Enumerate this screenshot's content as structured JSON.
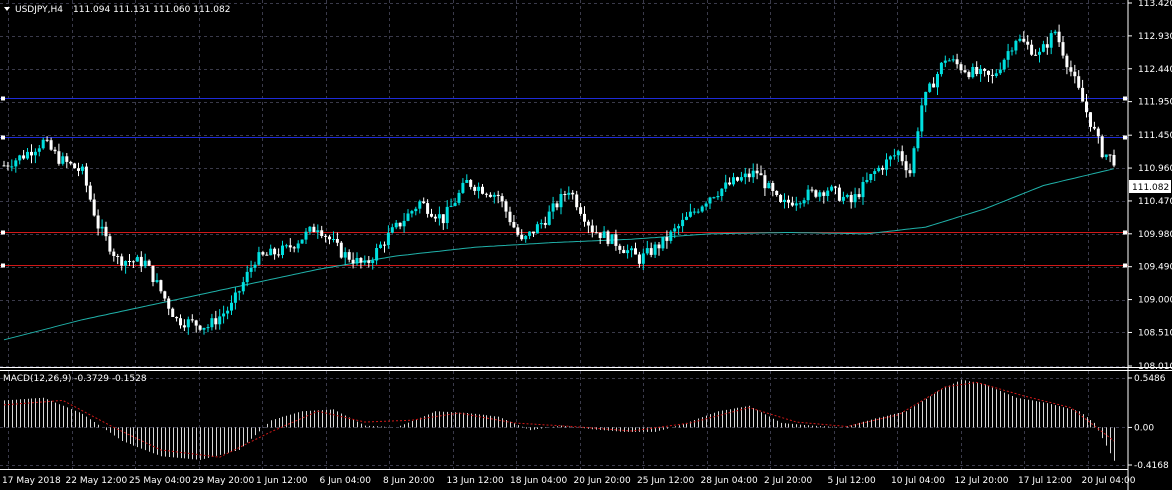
{
  "header": {
    "symbol": "USDJPY,H4",
    "ohlc": "111.094 111.131 111.060 111.082"
  },
  "macd_header": {
    "label": "MACD(12,26,9) -0.3729 -0.1528"
  },
  "price_axis": {
    "ticks": [
      "113.420",
      "112.930",
      "112.440",
      "111.950",
      "111.450",
      "110.960",
      "110.470",
      "109.980",
      "109.490",
      "109.000",
      "108.510",
      "108.010"
    ],
    "current_price": "111.082"
  },
  "macd_axis": {
    "ticks": [
      "0.5486",
      "0.00",
      "-0.4168"
    ]
  },
  "time_axis": {
    "labels": [
      "17 May 2018",
      "22 May 12:00",
      "25 May 04:00",
      "29 May 20:00",
      "1 Jun 12:00",
      "6 Jun 04:00",
      "8 Jun 20:00",
      "13 Jun 12:00",
      "18 Jun 04:00",
      "20 Jun 20:00",
      "25 Jun 12:00",
      "28 Jun 04:00",
      "2 Jul 20:00",
      "5 Jul 12:00",
      "10 Jul 04:00",
      "12 Jul 20:00",
      "17 Jul 12:00",
      "20 Jul 04:00"
    ]
  },
  "horizontal_levels": {
    "blue": [
      112.0,
      111.42
    ],
    "red": [
      110.0,
      109.52
    ]
  },
  "colors": {
    "background": "#000000",
    "grid": "#3a3a4a",
    "axis": "#ffffff",
    "bull_candle": "#00e0e0",
    "bear_candle": "#ffffff",
    "moving_average": "#20b2aa",
    "blue_level": "#1e2bd8",
    "red_level": "#d01818",
    "macd_hist": "#d8d8d8",
    "macd_signal": "#d01818"
  },
  "chart_data": {
    "type": "candlestick",
    "title": "USDJPY,H4",
    "y_range": [
      108.01,
      113.42
    ],
    "key_points": [
      {
        "i": 0,
        "p": 111.0
      },
      {
        "i": 5,
        "p": 111.15
      },
      {
        "i": 10,
        "p": 111.35
      },
      {
        "i": 14,
        "p": 111.1
      },
      {
        "i": 20,
        "p": 110.9
      },
      {
        "i": 24,
        "p": 110.1
      },
      {
        "i": 29,
        "p": 109.6
      },
      {
        "i": 36,
        "p": 109.55
      },
      {
        "i": 44,
        "p": 108.7
      },
      {
        "i": 52,
        "p": 108.6
      },
      {
        "i": 58,
        "p": 108.9
      },
      {
        "i": 64,
        "p": 109.6
      },
      {
        "i": 72,
        "p": 109.75
      },
      {
        "i": 80,
        "p": 110.1
      },
      {
        "i": 86,
        "p": 109.7
      },
      {
        "i": 92,
        "p": 109.5
      },
      {
        "i": 98,
        "p": 109.95
      },
      {
        "i": 106,
        "p": 110.45
      },
      {
        "i": 112,
        "p": 110.2
      },
      {
        "i": 118,
        "p": 110.75
      },
      {
        "i": 126,
        "p": 110.55
      },
      {
        "i": 132,
        "p": 109.85
      },
      {
        "i": 138,
        "p": 110.2
      },
      {
        "i": 144,
        "p": 110.65
      },
      {
        "i": 150,
        "p": 110.05
      },
      {
        "i": 156,
        "p": 109.85
      },
      {
        "i": 162,
        "p": 109.6
      },
      {
        "i": 168,
        "p": 109.85
      },
      {
        "i": 174,
        "p": 110.2
      },
      {
        "i": 180,
        "p": 110.55
      },
      {
        "i": 186,
        "p": 110.75
      },
      {
        "i": 192,
        "p": 110.9
      },
      {
        "i": 198,
        "p": 110.4
      },
      {
        "i": 204,
        "p": 110.55
      },
      {
        "i": 210,
        "p": 110.65
      },
      {
        "i": 216,
        "p": 110.45
      },
      {
        "i": 222,
        "p": 110.9
      },
      {
        "i": 228,
        "p": 111.2
      },
      {
        "i": 231,
        "p": 110.9
      },
      {
        "i": 234,
        "p": 111.9
      },
      {
        "i": 240,
        "p": 112.6
      },
      {
        "i": 246,
        "p": 112.4
      },
      {
        "i": 252,
        "p": 112.3
      },
      {
        "i": 258,
        "p": 112.9
      },
      {
        "i": 264,
        "p": 112.65
      },
      {
        "i": 268,
        "p": 113.0
      },
      {
        "i": 272,
        "p": 112.4
      },
      {
        "i": 276,
        "p": 111.8
      },
      {
        "i": 280,
        "p": 111.2
      },
      {
        "i": 283,
        "p": 111.08
      }
    ],
    "moving_average": [
      {
        "i": 0,
        "p": 108.4
      },
      {
        "i": 20,
        "p": 108.7
      },
      {
        "i": 40,
        "p": 108.95
      },
      {
        "i": 60,
        "p": 109.2
      },
      {
        "i": 80,
        "p": 109.45
      },
      {
        "i": 100,
        "p": 109.65
      },
      {
        "i": 120,
        "p": 109.78
      },
      {
        "i": 140,
        "p": 109.85
      },
      {
        "i": 160,
        "p": 109.9
      },
      {
        "i": 180,
        "p": 109.98
      },
      {
        "i": 200,
        "p": 110.0
      },
      {
        "i": 220,
        "p": 109.98
      },
      {
        "i": 235,
        "p": 110.08
      },
      {
        "i": 250,
        "p": 110.35
      },
      {
        "i": 265,
        "p": 110.7
      },
      {
        "i": 283,
        "p": 110.95
      }
    ],
    "macd_hist": [
      {
        "i": 0,
        "v": 0.3
      },
      {
        "i": 10,
        "v": 0.33
      },
      {
        "i": 20,
        "v": 0.15
      },
      {
        "i": 30,
        "v": -0.15
      },
      {
        "i": 40,
        "v": -0.32
      },
      {
        "i": 50,
        "v": -0.36
      },
      {
        "i": 60,
        "v": -0.25
      },
      {
        "i": 68,
        "v": 0.08
      },
      {
        "i": 76,
        "v": 0.18
      },
      {
        "i": 84,
        "v": 0.2
      },
      {
        "i": 92,
        "v": 0.02
      },
      {
        "i": 100,
        "v": 0.0
      },
      {
        "i": 110,
        "v": 0.18
      },
      {
        "i": 118,
        "v": 0.16
      },
      {
        "i": 126,
        "v": 0.12
      },
      {
        "i": 134,
        "v": -0.03
      },
      {
        "i": 142,
        "v": 0.02
      },
      {
        "i": 150,
        "v": -0.02
      },
      {
        "i": 158,
        "v": -0.05
      },
      {
        "i": 166,
        "v": -0.05
      },
      {
        "i": 174,
        "v": 0.05
      },
      {
        "i": 182,
        "v": 0.18
      },
      {
        "i": 190,
        "v": 0.24
      },
      {
        "i": 198,
        "v": 0.05
      },
      {
        "i": 206,
        "v": 0.02
      },
      {
        "i": 214,
        "v": 0.0
      },
      {
        "i": 222,
        "v": 0.1
      },
      {
        "i": 230,
        "v": 0.18
      },
      {
        "i": 238,
        "v": 0.4
      },
      {
        "i": 244,
        "v": 0.53
      },
      {
        "i": 250,
        "v": 0.48
      },
      {
        "i": 258,
        "v": 0.33
      },
      {
        "i": 266,
        "v": 0.27
      },
      {
        "i": 274,
        "v": 0.18
      },
      {
        "i": 278,
        "v": 0.05
      },
      {
        "i": 283,
        "v": -0.37
      }
    ],
    "macd_signal": [
      {
        "i": 0,
        "v": 0.25
      },
      {
        "i": 15,
        "v": 0.3
      },
      {
        "i": 28,
        "v": 0.0
      },
      {
        "i": 40,
        "v": -0.25
      },
      {
        "i": 55,
        "v": -0.33
      },
      {
        "i": 68,
        "v": -0.05
      },
      {
        "i": 80,
        "v": 0.18
      },
      {
        "i": 92,
        "v": 0.06
      },
      {
        "i": 104,
        "v": 0.08
      },
      {
        "i": 116,
        "v": 0.16
      },
      {
        "i": 130,
        "v": 0.05
      },
      {
        "i": 145,
        "v": 0.01
      },
      {
        "i": 160,
        "v": -0.04
      },
      {
        "i": 175,
        "v": 0.05
      },
      {
        "i": 190,
        "v": 0.22
      },
      {
        "i": 202,
        "v": 0.06
      },
      {
        "i": 215,
        "v": 0.01
      },
      {
        "i": 228,
        "v": 0.14
      },
      {
        "i": 240,
        "v": 0.45
      },
      {
        "i": 248,
        "v": 0.5
      },
      {
        "i": 260,
        "v": 0.35
      },
      {
        "i": 272,
        "v": 0.22
      },
      {
        "i": 283,
        "v": -0.15
      }
    ],
    "macd_range": [
      -0.4168,
      0.5486
    ]
  }
}
